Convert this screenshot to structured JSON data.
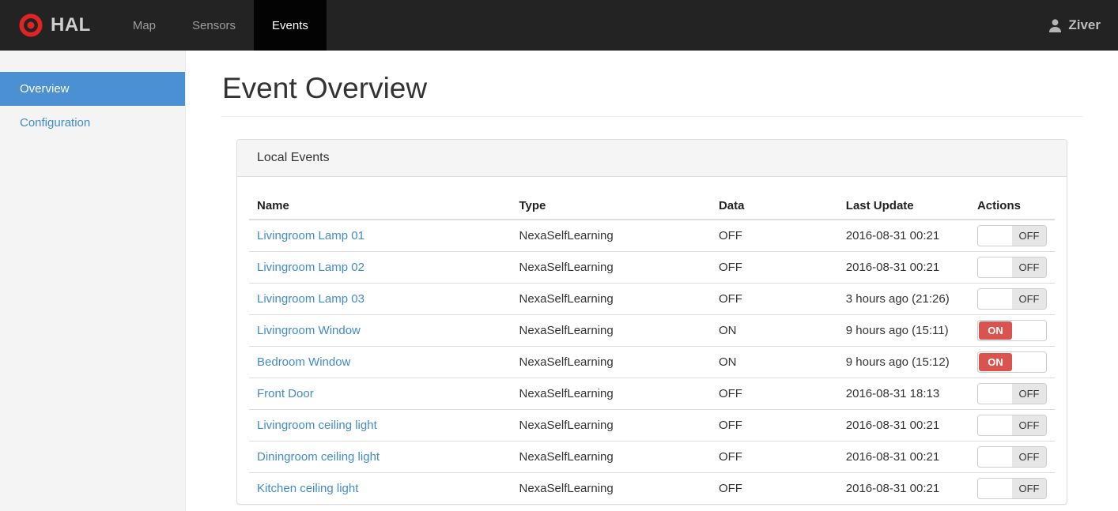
{
  "navbar": {
    "brand": "HAL",
    "brand_icon": "target-icon",
    "tabs": [
      {
        "label": "Map",
        "active": false
      },
      {
        "label": "Sensors",
        "active": false
      },
      {
        "label": "Events",
        "active": true
      }
    ],
    "user": "Ziver",
    "user_icon": "person-icon"
  },
  "sidebar": {
    "items": [
      {
        "label": "Overview",
        "active": true
      },
      {
        "label": "Configuration",
        "active": false
      }
    ]
  },
  "main": {
    "title": "Event Overview",
    "panel": {
      "title": "Local Events",
      "table": {
        "headers": [
          "Name",
          "Type",
          "Data",
          "Last Update",
          "Actions"
        ],
        "rows": [
          {
            "name": "Livingroom Lamp 01",
            "type": "NexaSelfLearning",
            "data": "OFF",
            "last_update": "2016-08-31 00:21",
            "toggle": "OFF"
          },
          {
            "name": "Livingroom Lamp 02",
            "type": "NexaSelfLearning",
            "data": "OFF",
            "last_update": "2016-08-31 00:21",
            "toggle": "OFF"
          },
          {
            "name": "Livingroom Lamp 03",
            "type": "NexaSelfLearning",
            "data": "OFF",
            "last_update": "3 hours ago (21:26)",
            "toggle": "OFF"
          },
          {
            "name": "Livingroom Window",
            "type": "NexaSelfLearning",
            "data": "ON",
            "last_update": "9 hours ago (15:11)",
            "toggle": "ON"
          },
          {
            "name": "Bedroom Window",
            "type": "NexaSelfLearning",
            "data": "ON",
            "last_update": "9 hours ago (15:12)",
            "toggle": "ON"
          },
          {
            "name": "Front Door",
            "type": "NexaSelfLearning",
            "data": "OFF",
            "last_update": "2016-08-31 18:13",
            "toggle": "OFF"
          },
          {
            "name": "Livingroom ceiling light",
            "type": "NexaSelfLearning",
            "data": "OFF",
            "last_update": "2016-08-31 00:21",
            "toggle": "OFF"
          },
          {
            "name": "Diningroom ceiling light",
            "type": "NexaSelfLearning",
            "data": "OFF",
            "last_update": "2016-08-31 00:21",
            "toggle": "OFF"
          },
          {
            "name": "Kitchen ceiling light",
            "type": "NexaSelfLearning",
            "data": "OFF",
            "last_update": "2016-08-31 00:21",
            "toggle": "OFF"
          }
        ]
      }
    }
  },
  "colors": {
    "navbar_bg": "#232323",
    "active_tab_bg": "#030303",
    "sidebar_active_blue": "#4a90d2",
    "link_blue": "#428bca",
    "toggle_on_red": "#d9534f",
    "toggle_off_gray": "#e6e6e6",
    "logo_red": "#e02424"
  }
}
